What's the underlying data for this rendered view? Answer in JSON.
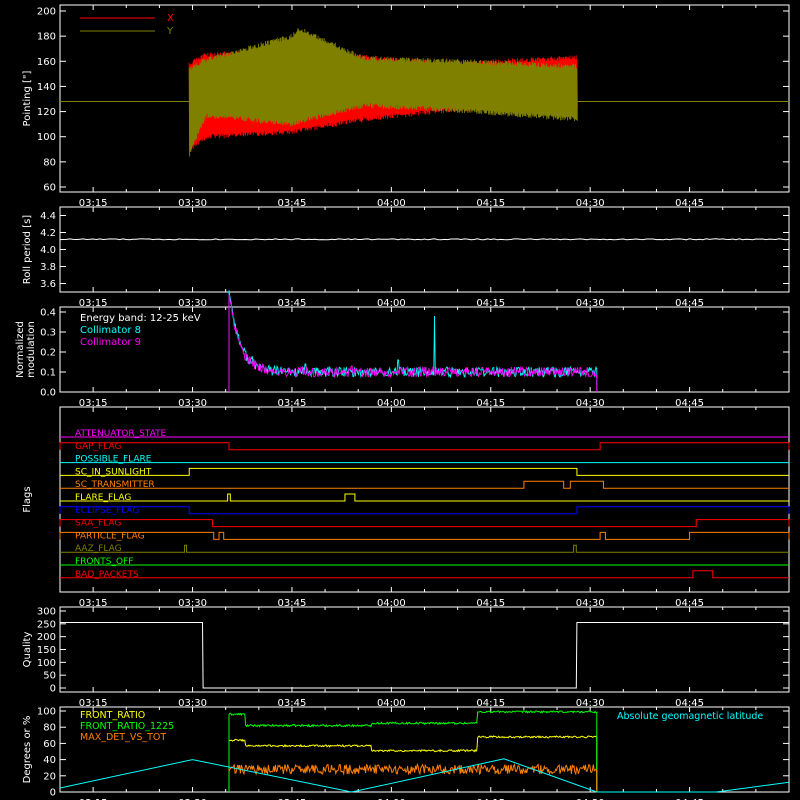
{
  "time_ticks": [
    "03:15",
    "03:30",
    "03:45",
    "04:00",
    "04:15",
    "04:30",
    "04:45"
  ],
  "time_range_minutes": [
    190,
    300
  ],
  "chart_data": [
    {
      "type": "line",
      "title": "",
      "xlabel": "",
      "ylabel": "Pointing [\"]",
      "ylim": [
        60,
        200
      ],
      "yticks": [
        "60",
        "80",
        "100",
        "120",
        "140",
        "160",
        "180",
        "200"
      ],
      "yticks_values": [
        60,
        80,
        100,
        120,
        140,
        160,
        180,
        200
      ],
      "grid": false,
      "legend_position": "top-left",
      "baseline": 128,
      "data_window": [
        209.5,
        268
      ],
      "series": [
        {
          "name": "X",
          "color": "#ff0000",
          "envelope": {
            "t": [
              209.5,
              212,
              225,
              236,
              250,
              268
            ],
            "upper": [
              160,
              167,
              172,
              165,
              160,
              165
            ],
            "lower": [
              88,
              98,
              102,
              112,
              120,
              122
            ]
          }
        },
        {
          "name": "Y",
          "color": "#808000",
          "envelope": {
            "t": [
              209.5,
              212,
              225,
              226,
              236,
              250,
              268
            ],
            "upper": [
              156,
              163,
              182,
              188,
              164,
              162,
              158
            ],
            "lower": [
              84,
              115,
              108,
              110,
              123,
              119,
              112
            ]
          }
        }
      ]
    },
    {
      "type": "line",
      "title": "",
      "xlabel": "",
      "ylabel": "Roll period [s]",
      "ylim": [
        3.5,
        4.5
      ],
      "yticks": [
        "3.6",
        "3.8",
        "4.0",
        "4.2",
        "4.4"
      ],
      "yticks_values": [
        3.6,
        3.8,
        4.0,
        4.2,
        4.4
      ],
      "grid": false,
      "series": [
        {
          "name": "",
          "color": "#ffffff",
          "x": [
            190,
            300
          ],
          "y": [
            4.12,
            4.12
          ]
        }
      ]
    },
    {
      "type": "line",
      "title": "",
      "xlabel": "",
      "ylabel": "Normalized modulation",
      "ylabel_lines": [
        "Normalized",
        "modulation"
      ],
      "ylim": [
        0,
        0.4
      ],
      "yticks": [
        "0.0",
        "0.1",
        "0.2",
        "0.3",
        "0.4"
      ],
      "yticks_values": [
        0,
        0.1,
        0.2,
        0.3,
        0.4
      ],
      "grid": false,
      "legend_position": "top-left",
      "annotation": "Energy band: 12-25 keV",
      "data_window": [
        215.5,
        271
      ],
      "series": [
        {
          "name": "Collimator 8",
          "color": "#00ffff",
          "level": 0.1,
          "peak": 0.42,
          "spikes": [
            {
              "t": 219,
              "y": 0.18
            },
            {
              "t": 241,
              "y": 0.16
            },
            {
              "t": 246.5,
              "y": 0.38
            },
            {
              "t": 227,
              "y": 0.14
            }
          ]
        },
        {
          "name": "Collimator 9",
          "color": "#ff00ff",
          "level": 0.1,
          "peak": 0.4,
          "spikes": [
            {
              "t": 218,
              "y": 0.16
            },
            {
              "t": 234,
              "y": 0.13
            }
          ]
        }
      ]
    },
    {
      "type": "line",
      "title": "",
      "xlabel": "",
      "ylabel": "Flags",
      "grid": false,
      "series": [
        {
          "name": "ATTENUATOR_STATE",
          "color": "#ff00ff",
          "high": []
        },
        {
          "name": "GAP_FLAG",
          "color": "#ff0000",
          "high": [
            [
              190,
              215.5
            ],
            [
              271.5,
              300
            ]
          ]
        },
        {
          "name": "POSSIBLE_FLARE",
          "color": "#00ffff",
          "high": []
        },
        {
          "name": "SC_IN_SUNLIGHT",
          "color": "#ffff00",
          "high": [
            [
              209.5,
              268
            ]
          ]
        },
        {
          "name": "SC_TRANSMITTER",
          "color": "#ff8000",
          "high": [
            [
              260,
              266
            ],
            [
              267,
              272
            ]
          ]
        },
        {
          "name": "FLARE_FLAG",
          "color": "#ffff00",
          "high": [
            [
              215.3,
              215.7
            ],
            [
              233,
              234.5
            ]
          ]
        },
        {
          "name": "ECLIPSE_FLAG",
          "color": "#0000ff",
          "high": [
            [
              190,
              209.5
            ],
            [
              268,
              300
            ]
          ]
        },
        {
          "name": "SAA_FLAG",
          "color": "#ff0000",
          "high": [
            [
              190,
              213
            ],
            [
              286,
              300
            ]
          ]
        },
        {
          "name": "PARTICLE_FLAG",
          "color": "#ff8000",
          "high": [
            [
              190,
              213.2
            ],
            [
              214,
              214.7
            ],
            [
              271.5,
              272.3
            ],
            [
              285,
              300
            ]
          ]
        },
        {
          "name": "AAZ_FLAG",
          "color": "#808000",
          "high": [
            [
              208.8,
              209.1
            ],
            [
              267.5,
              267.9
            ]
          ]
        },
        {
          "name": "FRONTS_OFF",
          "color": "#00ff00",
          "high": []
        },
        {
          "name": "BAD_PACKETS",
          "color": "#ff0000",
          "high": [
            [
              285.5,
              288.5
            ]
          ]
        }
      ]
    },
    {
      "type": "line",
      "title": "",
      "xlabel": "",
      "ylabel": "Quality",
      "ylim": [
        0,
        300
      ],
      "yticks": [
        "0",
        "50",
        "100",
        "150",
        "200",
        "250",
        "300"
      ],
      "yticks_values": [
        0,
        50,
        100,
        150,
        200,
        250,
        300
      ],
      "grid": false,
      "series": [
        {
          "name": "",
          "color": "#ffffff",
          "x": [
            190,
            211.5,
            211.6,
            267.9,
            268,
            300
          ],
          "y": [
            255,
            255,
            0,
            0,
            255,
            255
          ]
        }
      ]
    },
    {
      "type": "line",
      "title": "",
      "xlabel": "",
      "ylabel": "Degrees or %",
      "ylim": [
        0,
        100
      ],
      "yticks": [
        "0",
        "20",
        "40",
        "60",
        "80",
        "100"
      ],
      "yticks_values": [
        0,
        20,
        40,
        60,
        80,
        100
      ],
      "grid": false,
      "legend_position": "top-left",
      "series": [
        {
          "name": "FRONT_RATIO",
          "color": "#ffff00",
          "x": [
            215.5,
            215.5,
            218,
            218,
            237,
            237,
            253,
            253,
            271,
            271
          ],
          "y": [
            0,
            64,
            64,
            57,
            57,
            51,
            51,
            68,
            68,
            0
          ],
          "noise": 1.2
        },
        {
          "name": "FRONT_RATIO_1225",
          "color": "#00ff00",
          "x": [
            215.5,
            215.5,
            218,
            218,
            237,
            237,
            253,
            253,
            271,
            271
          ],
          "y": [
            0,
            96,
            96,
            82,
            82,
            85,
            85,
            99,
            99,
            0
          ],
          "noise": 1.2
        },
        {
          "name": "MAX_DET_VS_TOT",
          "color": "#ff8000",
          "x": [
            215.5,
            271
          ],
          "y": [
            28,
            28
          ],
          "noise": 6
        },
        {
          "name": "Absolute geomagnetic latitude",
          "color": "#00ffff",
          "x": [
            190,
            210,
            234,
            257,
            271,
            289,
            300
          ],
          "y": [
            5,
            40,
            0,
            41,
            0,
            0,
            12
          ]
        }
      ]
    }
  ]
}
